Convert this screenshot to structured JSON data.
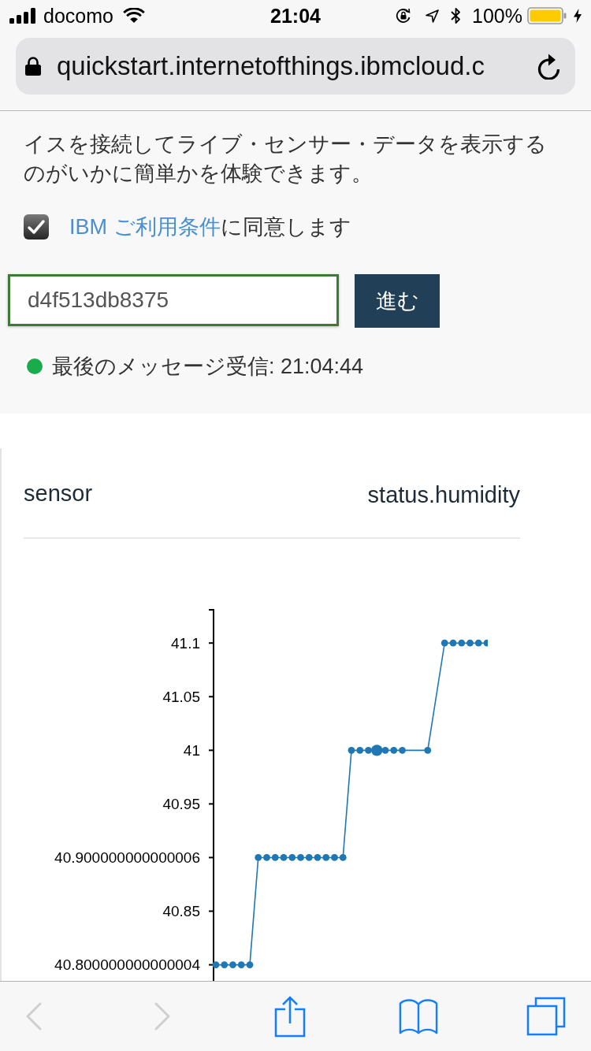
{
  "status_bar": {
    "carrier": "docomo",
    "time": "21:04",
    "battery": "100%"
  },
  "address_bar": {
    "url": "quickstart.internetofthings.ibmcloud.c"
  },
  "intro": {
    "text": "イスを接続してライブ・センサー・データを表示するのがいかに簡単かを体験できます。"
  },
  "terms": {
    "checked": true,
    "link": "IBM ご利用条件",
    "text": "に同意します"
  },
  "device_form": {
    "value": "d4f513db8375",
    "button": "進む"
  },
  "connection": {
    "connected": true,
    "text": "最後のメッセージ受信: 21:04:44"
  },
  "card": {
    "title": "sensor",
    "property": "status.humidity",
    "chart_data": {
      "type": "line",
      "categories": [
        null,
        null,
        null,
        null,
        null,
        null,
        null,
        null,
        null,
        null,
        null,
        null,
        null,
        null,
        null,
        null,
        null,
        null,
        null,
        null,
        null,
        null,
        null,
        null,
        null,
        null,
        null,
        null,
        null,
        null,
        null,
        null,
        null
      ],
      "series": [
        {
          "color": "#1f77b4",
          "marker": "circle",
          "values": [
            40.8,
            40.8,
            40.8,
            40.8,
            40.8,
            40.9,
            40.9,
            40.9,
            40.9,
            40.9,
            40.9,
            40.9,
            40.9,
            40.9,
            40.9,
            40.9,
            41,
            41,
            41,
            41,
            41,
            41,
            41,
            null,
            null,
            41,
            null,
            41.1,
            41.1,
            41.1,
            41.1,
            41.1,
            41.1
          ]
        },
        {
          "color": "#1f77b4",
          "marker": "circle",
          "values": [
            null,
            null,
            null,
            null,
            null,
            null,
            null,
            null,
            null,
            null,
            null,
            null,
            null,
            null,
            null,
            null,
            null,
            null,
            null,
            41,
            null,
            null,
            null,
            null,
            null,
            null,
            null,
            null,
            null,
            null,
            null,
            null,
            null
          ]
        }
      ],
      "ylim": [
        40.785,
        41.131
      ],
      "yticks": [
        {
          "value": 40.8,
          "label": "40.800000000000004"
        },
        {
          "value": 40.85,
          "label": "40.85"
        },
        {
          "value": 40.9,
          "label": "40.900000000000006"
        },
        {
          "value": 40.95,
          "label": "40.95"
        },
        {
          "value": 41,
          "label": "41"
        },
        {
          "value": 41.05,
          "label": "41.05"
        },
        {
          "value": 41.1,
          "label": "41.1"
        }
      ]
    }
  },
  "toolbar": [
    {
      "kind": "back",
      "disabled": true
    },
    {
      "kind": "forward",
      "disabled": true
    },
    {
      "kind": "share",
      "disabled": false
    },
    {
      "kind": "bookmarks",
      "disabled": false
    },
    {
      "kind": "tabs",
      "disabled": false
    }
  ]
}
